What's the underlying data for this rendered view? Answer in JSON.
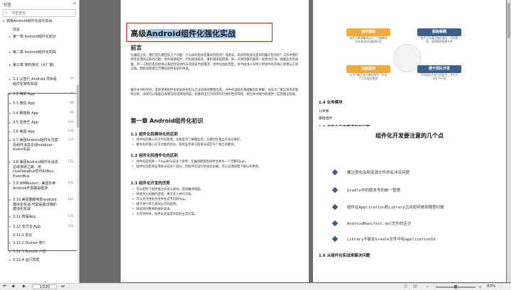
{
  "sidebar": {
    "title": "书签",
    "close_icon": "×",
    "search_placeholder": "书签查找",
    "items": [
      {
        "label": "高级Android组件化强化实战",
        "level": 0,
        "arrow": "▾"
      },
      {
        "label": "前言",
        "level": 1,
        "arrow": ""
      },
      {
        "label": "第一章 Android组件化初识",
        "level": 1,
        "arrow": "▸"
      },
      {
        "label": "第二章 Android组件化初探",
        "level": 1,
        "arrow": "▸"
      },
      {
        "label": "第三章 架构演化（大厂篇）",
        "level": 1,
        "arrow": "▾"
      },
      {
        "label": "3.1 从智行 Android 项目看组件化架构实践",
        "level": 2,
        "arrow": "▸",
        "page": "29"
      },
      {
        "label": "3.2 得到 App",
        "level": 2,
        "arrow": "▸",
        "page": "75"
      },
      {
        "label": "3.3 微信 App",
        "level": 2,
        "arrow": "▸",
        "page": "88"
      },
      {
        "label": "3.4 蘑菇街 App",
        "level": 2,
        "arrow": "▸",
        "page": "98"
      },
      {
        "label": "3.5 爱奇艺 App",
        "level": 2,
        "arrow": "▸",
        "page": "104"
      },
      {
        "label": "3.6 美团 App",
        "level": 2,
        "arrow": "▸",
        "page": "109"
      },
      {
        "label": "3.7 美团Android组件化方案及组件消息总线modular-event实战",
        "level": 2,
        "arrow": "▸",
        "page": "124"
      },
      {
        "label": "3.8 美团Android组件化消息总线演进之路：用LiveDataBus替代RxBus、EventBus",
        "level": 2,
        "arrow": "▸",
        "page": "133"
      },
      {
        "label": "3.9 WMRouter：美团外卖Android开源路由框架",
        "level": 2,
        "arrow": "▸",
        "page": "145"
      },
      {
        "label": "3.10 美团猫眼电影android模块化实战-可能是最详细的模块化实战",
        "level": 2,
        "arrow": "▸",
        "page": "165"
      },
      {
        "label": "3.11 携程App",
        "level": 2,
        "arrow": "▸",
        "page": "176"
      },
      {
        "label": "3.12 支付宝 App",
        "level": 2,
        "arrow": "▾",
        "page": "181"
      },
      {
        "label": "3.12.1 前言",
        "level": 3,
        "arrow": ""
      },
      {
        "label": "3.12.2 Quinox 简介",
        "level": 3,
        "arrow": "▸"
      },
      {
        "label": "3.12.3 Bundle 介绍",
        "level": 3,
        "arrow": "▸"
      },
      {
        "label": "3.12.4 运行原理",
        "level": 3,
        "arrow": "▸"
      }
    ]
  },
  "bottom": {
    "page_value": "1/220",
    "zoom": "83%"
  },
  "doc": {
    "title_plain": "高级",
    "title_hl": "Android组件化强化实战",
    "preface_heading": "前言",
    "preface_p1": "在编程之前，我们首先要回答几个问题：什么样的程序是最好的程序？或者说，高效的程序员是如何编写程序的？工作中我们经常会遇到这样的问题：项目越来越大，代码越来越多，维护越来越困难，每一次修改都可能牵一发而动全身。随着业务的发展，单一工程结构已经难以满足团队协作与快速迭代的需求，组件化由此而生。本书由浅入深地介绍组件化的核心思想与工程实践，帮助读者建立完整的组件化知识体系。",
    "preface_p2": "编写本书的目的，是希望把组件化相关的经验与方法系统地整理出来。书中内容既有基础概念的讲解，也有大厂真实项目的架构分析，读者可以根据自身情况有选择地阅读。如果你正在为项目的可维护性而烦恼，相信本书能为你提供一些思路与帮助。",
    "ch1_heading": "第一章 Android组件化初识",
    "s11_heading": "1.1 组件化和模块化的区别",
    "s11_b1": "组件化的重心在于代码复用，主要是为了解耦业务，方便团队独立开发与维护。",
    "s11_b2": "模块化的重心在于功能的划分，按照业务将工程拆分成若干个独立的模块。",
    "s12_heading": "1.2 组件化和插件化的区别",
    "s12_b1": "组件化是指将一个App拆分成多个组件，在编译期将各组件合并为一个完整的apk。",
    "s12_b2": "插件化也是将应用拆分成多个部分，但插件在运行时动态加载，可以实现按需下载与热更新。",
    "s13_heading": "1.3 组件化开发的优势",
    "s13_b1": "可以把各个组件独立开发与调试，提高编译速度。",
    "s13_b2": "各组件之间耦合度低，便于多人并行开发。",
    "s13_b3": "可以灵活地组合组件生成不同的App。",
    "s13_b4": "便于进行单元测试与代码复用。",
    "s13_b5": "降低项目整体的维护成本。",
    "s13_b6": "大型项目中，组件化开发是目前的主流方案。"
  },
  "right": {
    "cards": [
      {
        "cap": "编译速度",
        "body": "组件可单独编译运行，大幅缩短开发调试时的编译时间",
        "color": "#f2a93b"
      },
      {
        "cap": "超级解耦",
        "body": "组件之间通过路由通信，代码隔离，彻底解除依赖关系",
        "color": "#3f5e8c"
      },
      {
        "cap": "功能重用",
        "body": "公共功能沉淀为基础组件，供多个业务组件复用",
        "color": "#f2a93b"
      },
      {
        "cap": "便于团队开发",
        "body": "不同团队负责不同组件，并行开发互不干扰",
        "color": "#3f5e8c"
      }
    ],
    "s14_heading": "1.4 业务模块",
    "s14_i1": "公共库",
    "s14_i2": "基础组件",
    "s15_heading": "1.5 组件化开发要遇到的问题",
    "slide_title": "组件化开发要注意的几个点",
    "slide_items": [
      "要注意包名和资源文件命名冲突问题",
      "Gradle中的版本号的统一管理",
      "组件在Application和Library之间如何做到随意切换",
      "AndroidManifest.xml文件的区分",
      "Library不能在Gradle文件中有applicationId"
    ],
    "s16_heading": "1.6 从组件化实战来解决问题"
  },
  "watermark": "CSDN @Android小贾"
}
